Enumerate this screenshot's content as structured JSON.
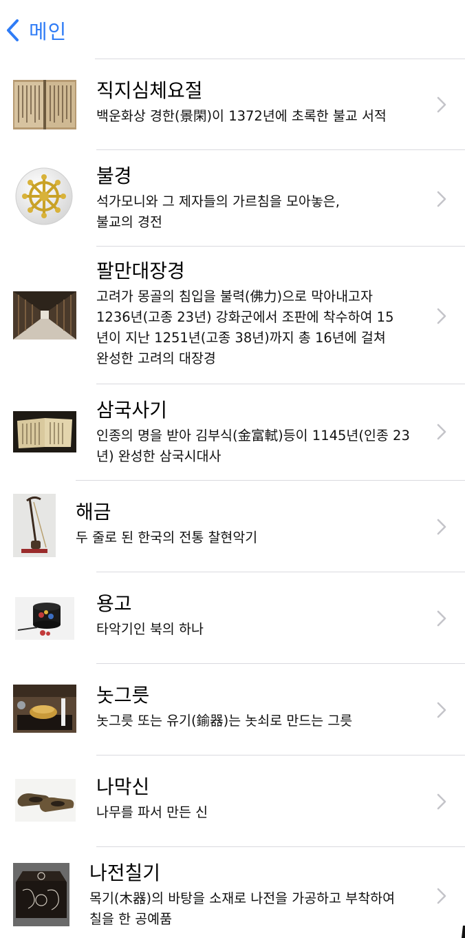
{
  "nav": {
    "back_label": "메인"
  },
  "accent": "#2f7cf6",
  "items": [
    {
      "title": "직지심체요절",
      "desc": "백운화상 경한(景閑)이 1372년에 초록한 불교 서적",
      "icon": "old-book-page-photo"
    },
    {
      "title": "불경",
      "desc": "석가모니와 그 제자들의 가르침을 모아놓은,\n불교의 경전",
      "icon": "dharma-wheel-icon"
    },
    {
      "title": "팔만대장경",
      "desc": "고려가 몽골의 침입을 불력(佛力)으로 막아내고자\n1236년(고종 23년) 강화군에서 조판에 착수하여 15\n년이 지난 1251년(고종 38년)까지 총 16년에 걸쳐\n완성한 고려의 대장경",
      "icon": "tripitaka-hall-photo"
    },
    {
      "title": "삼국사기",
      "desc": "인종의 명을 받아 김부식(金富軾)등이 1145년(인종 23\n년) 완성한 삼국시대사",
      "icon": "open-book-photo"
    },
    {
      "title": "해금",
      "desc": "두 줄로 된 한국의 전통 찰현악기",
      "icon": "haegeum-photo"
    },
    {
      "title": "용고",
      "desc": "타악기인 북의 하나",
      "icon": "yonggo-drum-photo"
    },
    {
      "title": "놋그릇",
      "desc": "놋그릇 또는 유기(鍮器)는 놋쇠로 만드는 그릇",
      "icon": "brass-bowl-photo"
    },
    {
      "title": "나막신",
      "desc": "나무를 파서 만든 신",
      "icon": "wooden-shoes-photo"
    },
    {
      "title": "나전칠기",
      "desc": "목기(木器)의 바탕을 소재로 나전을 가공하고 부착하여\n칠을 한 공예품",
      "icon": "lacquer-box-photo"
    }
  ]
}
